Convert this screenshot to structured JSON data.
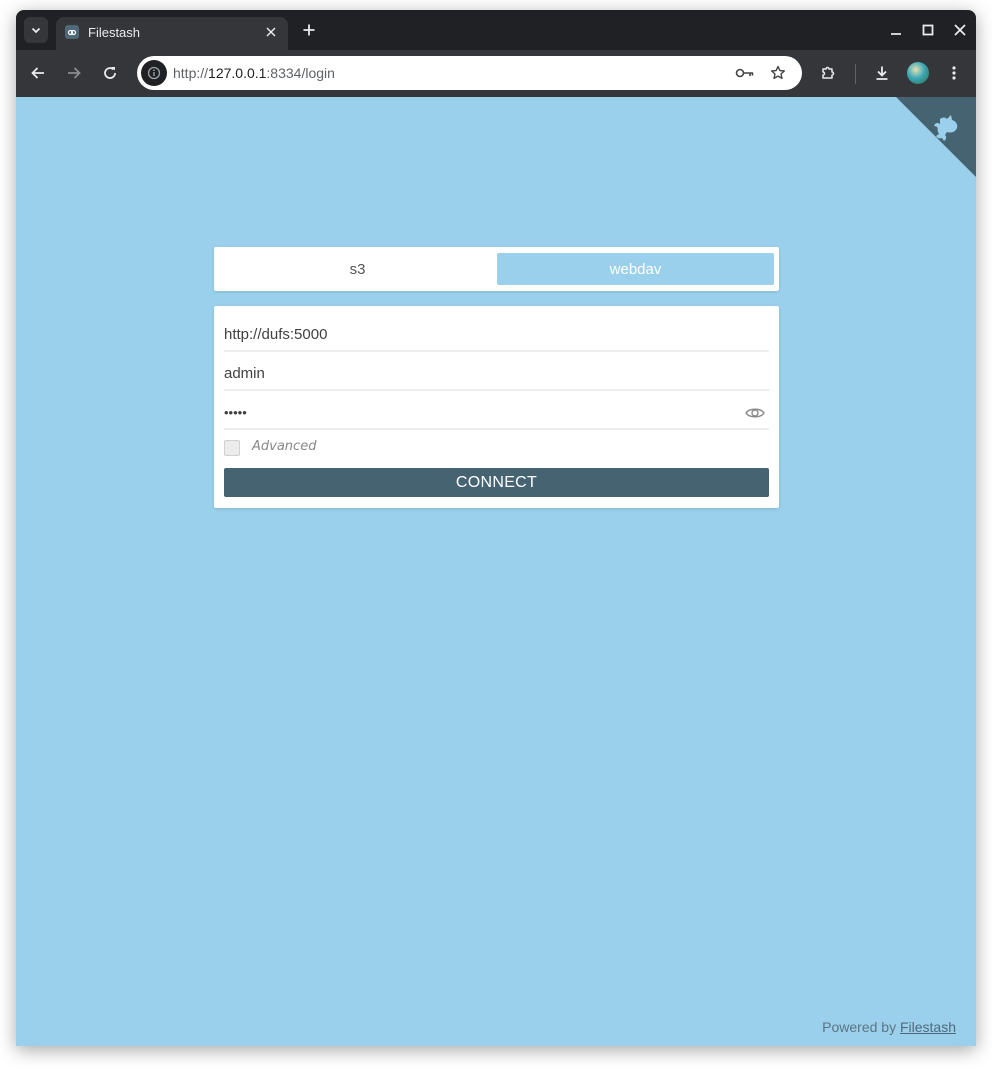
{
  "browser": {
    "tab_title": "Filestash",
    "url_scheme": "http://",
    "url_host": "127.0.0.1",
    "url_rest": ":8334/login"
  },
  "login": {
    "backends": [
      {
        "label": "s3",
        "active": false
      },
      {
        "label": "webdav",
        "active": true
      }
    ],
    "url_value": "http://dufs:5000",
    "username_value": "admin",
    "password_value": "admin",
    "advanced_label": "Advanced",
    "connect_label": "CONNECT"
  },
  "footer": {
    "powered_text": "Powered by",
    "link_text": "Filestash"
  },
  "colors": {
    "page_bg": "#9ad0eb",
    "button": "#466372",
    "corner": "#466372"
  },
  "icons": [
    "tab-search-icon",
    "filestash-favicon-icon",
    "close-icon",
    "plus-icon",
    "minimize-icon",
    "maximize-icon",
    "window-close-icon",
    "back-arrow-icon",
    "forward-arrow-icon",
    "reload-icon",
    "site-info-icon",
    "password-key-icon",
    "star-icon",
    "extensions-icon",
    "download-icon",
    "profile-avatar",
    "kebab-menu-icon",
    "github-corner-icon",
    "eye-icon"
  ]
}
